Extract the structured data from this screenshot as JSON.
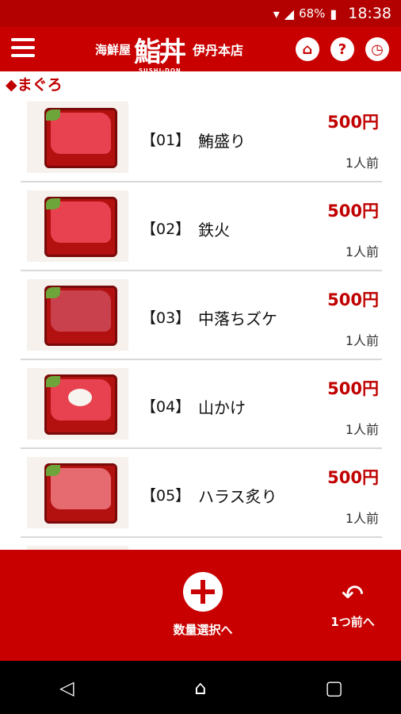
{
  "status_bar": {
    "battery_pct": "68%",
    "time": "18:38"
  },
  "header": {
    "brand_prefix": "海鮮屋",
    "brand_logo": "鮨丼",
    "brand_sub": "SUSHI-DON",
    "store_name": "伊丹本店",
    "icons": [
      "home-icon",
      "help-icon",
      "clock-icon"
    ]
  },
  "category": {
    "label": "◆まぐろ"
  },
  "items": [
    {
      "code": "【01】",
      "name": "鮪盛り",
      "price": "500円",
      "serving": "1人前"
    },
    {
      "code": "【02】",
      "name": "鉄火",
      "price": "500円",
      "serving": "1人前"
    },
    {
      "code": "【03】",
      "name": "中落ちズケ",
      "price": "500円",
      "serving": "1人前"
    },
    {
      "code": "【04】",
      "name": "山かけ",
      "price": "500円",
      "serving": "1人前"
    },
    {
      "code": "【05】",
      "name": "ハラス炙り",
      "price": "500円",
      "serving": "1人前"
    }
  ],
  "bottom_bar": {
    "quantity_label": "数量選択へ",
    "back_label": "1つ前へ"
  },
  "colors": {
    "brand_red": "#c80000",
    "price_red": "#c00000"
  }
}
